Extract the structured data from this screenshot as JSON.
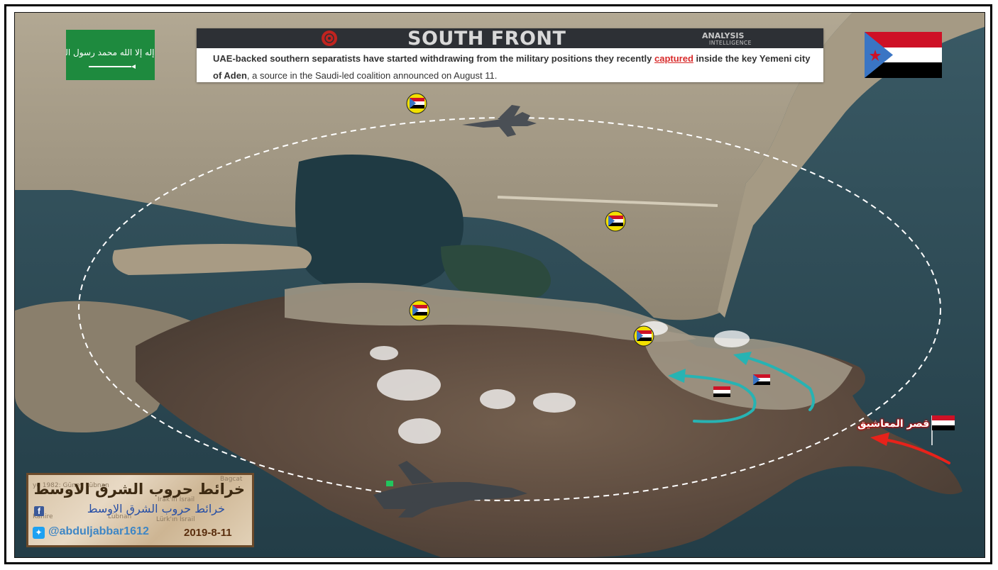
{
  "banner": {
    "brand": "SOUTH FRONT",
    "brand_sub1": "ANALYSIS",
    "brand_sub2": "INTELLIGENCE",
    "text_part1": "UAE-backed southern separatists have started withdrawing from the military positions they recently ",
    "text_highlight": "captured",
    "text_part2": " inside ",
    "text_bold": "the key Yemeni city of Aden",
    "text_part3": ", a source in the Saudi-led coalition announced on August 11."
  },
  "flags": {
    "saudi": "flag-saudi-arabia",
    "south_yemen": "flag-south-yemen",
    "yemen": "flag-yemen"
  },
  "saudi_flag_script": "لا إله إلا الله محمد رسول الله",
  "map_label": {
    "text": "قصر المعاشيق"
  },
  "watermark": {
    "title_ar": "خرائط حروب الشرق الاوسط",
    "subtitle_ar": "خرائط حروب الشرق الاوسط",
    "handle": "@abduljabbar1612",
    "date": "2019-8-11",
    "bg_fragments": [
      "ye 1982: Güney Lübnan",
      "Irak'ın İsrail",
      "Bagcat",
      "Kahire",
      "Lübnan",
      "Lürk'ın İsrail"
    ]
  },
  "markers": [
    {
      "name": "south-flag-marker-north",
      "icon": "south-yemen-flag-circle"
    },
    {
      "name": "south-flag-marker-east",
      "icon": "south-yemen-flag-circle"
    },
    {
      "name": "south-flag-marker-center",
      "icon": "south-yemen-flag-circle"
    },
    {
      "name": "south-flag-marker-crater",
      "icon": "south-yemen-flag-circle"
    }
  ],
  "colors": {
    "sea": "#2e4b55",
    "land": "#9a8d78",
    "mountain": "#5e4a3e",
    "arrow_withdraw": "#27b3b3",
    "arrow_advance": "#e8221a",
    "banner_dark": "#2d3035",
    "highlight_red": "#d82a2a"
  }
}
